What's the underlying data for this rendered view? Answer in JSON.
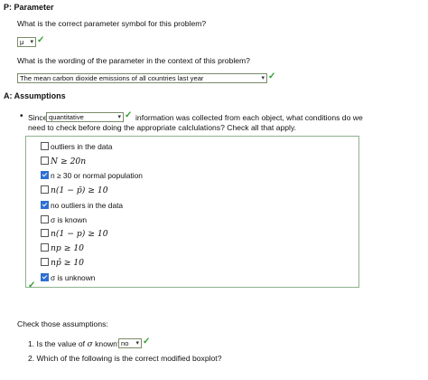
{
  "parameter": {
    "heading": "P: Parameter",
    "q1": "What is the correct parameter symbol for this problem?",
    "q1_value": "μ",
    "q2": "What is the wording of the parameter in the context of this problem?",
    "q2_value": "The mean carbon dioxide emissions of all countries last year"
  },
  "assumptions": {
    "heading": "A: Assumptions",
    "since_prefix": "Since",
    "since_value": "quantitative",
    "since_suffix_1": "information was collected from each object, what conditions do we",
    "since_suffix_2": "need to check before doing the appropriate calclulations?  Check all that apply.",
    "options": [
      {
        "label": "outliers in the data",
        "checked": false
      },
      {
        "label": "N ≥ 20n",
        "checked": false
      },
      {
        "label": "n ≥ 30 or normal population",
        "checked": true
      },
      {
        "label": "n(1 − p̄) ≥ 10",
        "checked": false
      },
      {
        "label": "no outliers in the data",
        "checked": true
      },
      {
        "label": "σ is known",
        "checked": false
      },
      {
        "label": "n(1 − p) ≥ 10",
        "checked": false
      },
      {
        "label": "np ≥ 10",
        "checked": false
      },
      {
        "label": "np̂ ≥ 10",
        "checked": false
      },
      {
        "label": "σ is unknown",
        "checked": true
      }
    ]
  },
  "check": {
    "heading": "Check those assumptions:",
    "q1_label": "1. Is the value of",
    "q1_symbol": "σ",
    "q1_tail": "known?",
    "q1_value": "no",
    "q2_label": "2. Which of the following is the correct modified boxplot?"
  },
  "colors": {
    "accent_check": "#2e9e2e",
    "checkbox_on": "#2f6fd0"
  }
}
